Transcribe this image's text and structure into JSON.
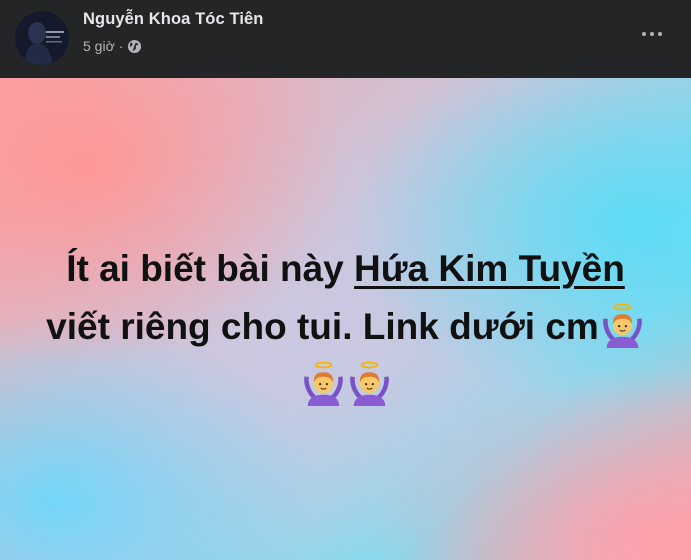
{
  "post": {
    "author_name": "Nguyễn Khoa Tóc Tiên",
    "timestamp": "5 giờ",
    "separator": "·",
    "privacy_icon": "globe-icon",
    "more_icon": "more-horizontal-icon",
    "message": {
      "text_1": "Ít ai biết bài này ",
      "mention": "Hứa Kim Tuyền",
      "text_2": " viết riêng cho tui. Link dưới cm",
      "emoji": [
        {
          "name": "person-gesturing-ok-icon",
          "char": "🙆"
        },
        {
          "name": "person-gesturing-ok-icon",
          "char": "🙆"
        },
        {
          "name": "person-gesturing-ok-icon",
          "char": "🙆"
        }
      ]
    },
    "colors": {
      "header_bg": "#242526",
      "name_color": "#e4e6eb",
      "meta_color": "#b0b3b8",
      "message_color": "#111111"
    }
  }
}
